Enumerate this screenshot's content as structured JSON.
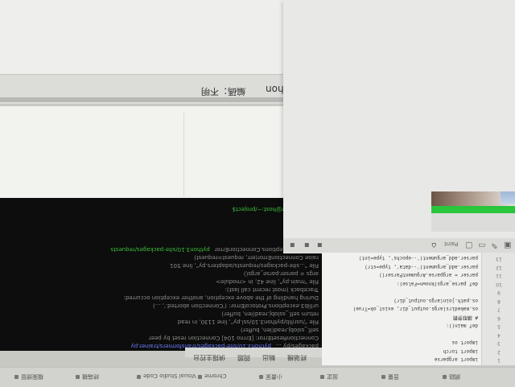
{
  "header": {
    "language": "Python",
    "encoding": "編碼：不明"
  },
  "terminal": {
    "lines": [
      {
        "text": "packages/py ...",
        "hl": "python3.10/site-packages/transformers/trainer.py"
      },
      {
        "text": "ConnectionResetError: [Errno 104] Connection reset by peer",
        "hl": ""
      },
      {
        "text": "    self._sslobj.read(len, buffer)",
        "hl": ""
      },
      {
        "text": "  File \"/usr/lib/python3.10/ssl.py\", line 1130, in read",
        "hl": ""
      },
      {
        "text": "    return self._sslobj.read(len, buffer)",
        "hl": ""
      },
      {
        "text": "urllib3.exceptions.ProtocolError: ('Connection aborted.', ...)",
        "hl": ""
      },
      {
        "text": "During handling of the above exception, another exception occurred:",
        "hl": ""
      },
      {
        "text": "Traceback (most recent call last):",
        "hl": ""
      },
      {
        "text": "  File \"main.py\", line 42, in <module>",
        "hl": ""
      },
      {
        "text": "    args = parser.parse_args()",
        "hl": ""
      },
      {
        "text": "  File \"...site-packages/requests/adapters.py\", line 501",
        "hl": ""
      },
      {
        "text": "    raise ConnectionError(err, request=request)",
        "hl": ""
      },
      {
        "text": "requests.exceptions.ConnectionError",
        "hl": "python3.10/site-packages/requests"
      },
      {
        "text": "",
        "hl": ""
      },
      {
        "text": "",
        "hl": ""
      },
      {
        "text": "",
        "hl": ""
      },
      {
        "text": "",
        "hl": ""
      },
      {
        "text": "",
        "hl": "(venv) user@host:~/project$"
      }
    ],
    "status": [
      "終端機",
      "輸出",
      "問題",
      "偵錯主控台"
    ]
  },
  "float_window": {
    "title": "Paint",
    "strip_icons": [
      "⌂",
      "▢",
      "▭",
      "✎",
      "▣",
      "✂"
    ],
    "small_icons": [
      "▪",
      "▪",
      "▪"
    ]
  },
  "editor": {
    "lines": [
      "import argparse",
      "import torch",
      "import os",
      "",
      "def main():",
      "    # 讀取參數",
      "    os.makedirs(args.output_dir, exist_ok=True)",
      "    os.path.join(args.output_dir)",
      "",
      "def parse_args(known=False):",
      "    parser = argparse.ArgumentParser()",
      "    parser.add_argument('--data', type=str)",
      "    parser.add_argument('--epochs', type=int)"
    ],
    "gutter": [
      "1",
      "2",
      "3",
      "4",
      "5",
      "6",
      "7",
      "8",
      "9",
      "10",
      "11",
      "12",
      "13"
    ]
  },
  "taskbar": {
    "items": [
      "檔案總管",
      "終端機",
      "Visual Studio Code",
      "Chrome",
      "小畫家",
      "設定",
      "音量",
      "網路"
    ]
  },
  "colors": {
    "terminal_bg": "#0c0d0c",
    "terminal_green": "#3fbf3f",
    "palette_green": "#29c53b",
    "panel_bg": "#e8e8e6"
  }
}
